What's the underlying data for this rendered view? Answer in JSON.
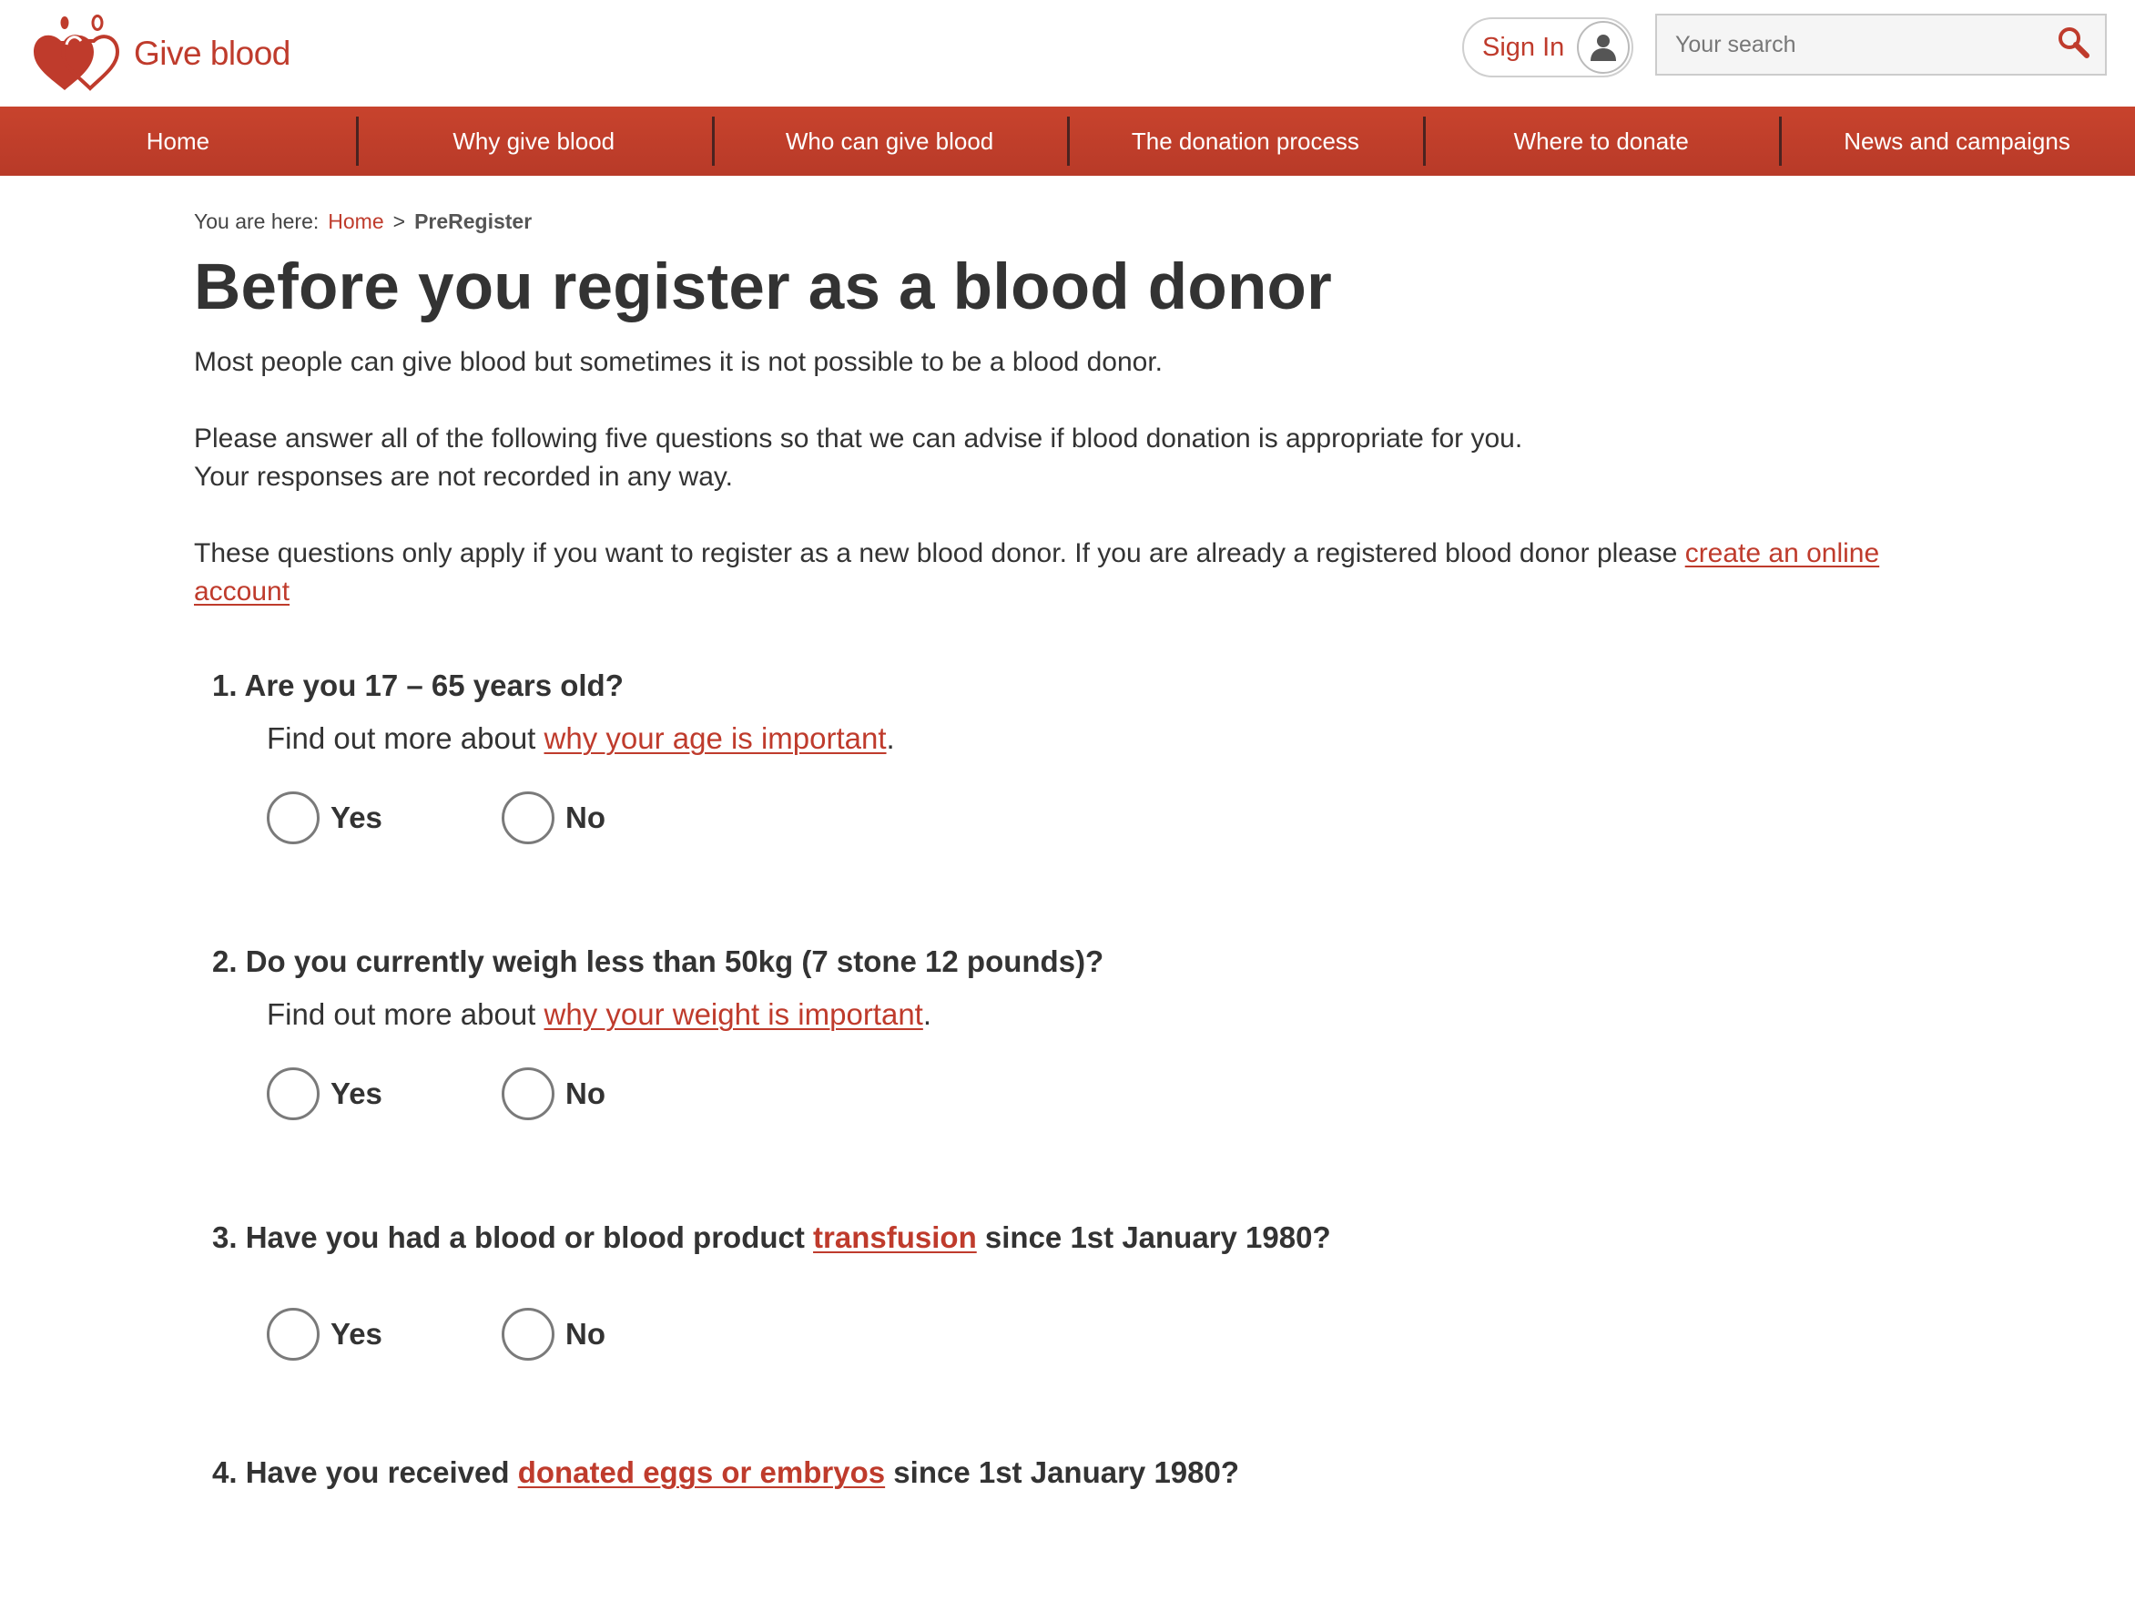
{
  "header": {
    "logo_text": "Give blood",
    "signin_label": "Sign In",
    "search_placeholder": "Your search"
  },
  "nav": {
    "items": [
      {
        "label": "Home"
      },
      {
        "label": "Why give blood"
      },
      {
        "label": "Who can give blood"
      },
      {
        "label": "The donation process"
      },
      {
        "label": "Where to donate"
      },
      {
        "label": "News and campaigns"
      }
    ]
  },
  "breadcrumb": {
    "prefix": "You are here:",
    "home": "Home",
    "separator": ">",
    "current": "PreRegister"
  },
  "page": {
    "title": "Before you register as a blood donor",
    "intro1": "Most people can give blood but sometimes it is not possible to be a blood donor.",
    "intro2a": "Please answer all of the following five questions so that we can advise if blood donation is appropriate for you.",
    "intro2b": "Your responses are not recorded in any way.",
    "intro3": "These questions only apply if you want to register as a new blood donor. If you are already a registered blood donor please ",
    "intro3_link": "create an online account"
  },
  "questions": [
    {
      "number": "1.",
      "text_before": "Are you 17 – 65 years old?",
      "more_prefix": "Find out more about ",
      "more_link": "why your age is important",
      "more_suffix": ".",
      "yes": "Yes",
      "no": "No"
    },
    {
      "number": "2.",
      "text_before": "Do you currently weigh less than 50kg (7 stone 12 pounds)?",
      "more_prefix": "Find out more about ",
      "more_link": "why your weight is important",
      "more_suffix": ".",
      "yes": "Yes",
      "no": "No"
    },
    {
      "number": "3.",
      "text_before": "Have you had a blood or blood product ",
      "link": "transfusion",
      "text_after": " since 1st January 1980?",
      "yes": "Yes",
      "no": "No"
    },
    {
      "number": "4.",
      "text_before": "Have you received ",
      "link": "donated eggs or embryos",
      "text_after": " since 1st January 1980?"
    }
  ],
  "colors": {
    "brand_red": "#bf3b2c",
    "nav_divider": "#4a2320",
    "text": "#333333"
  }
}
